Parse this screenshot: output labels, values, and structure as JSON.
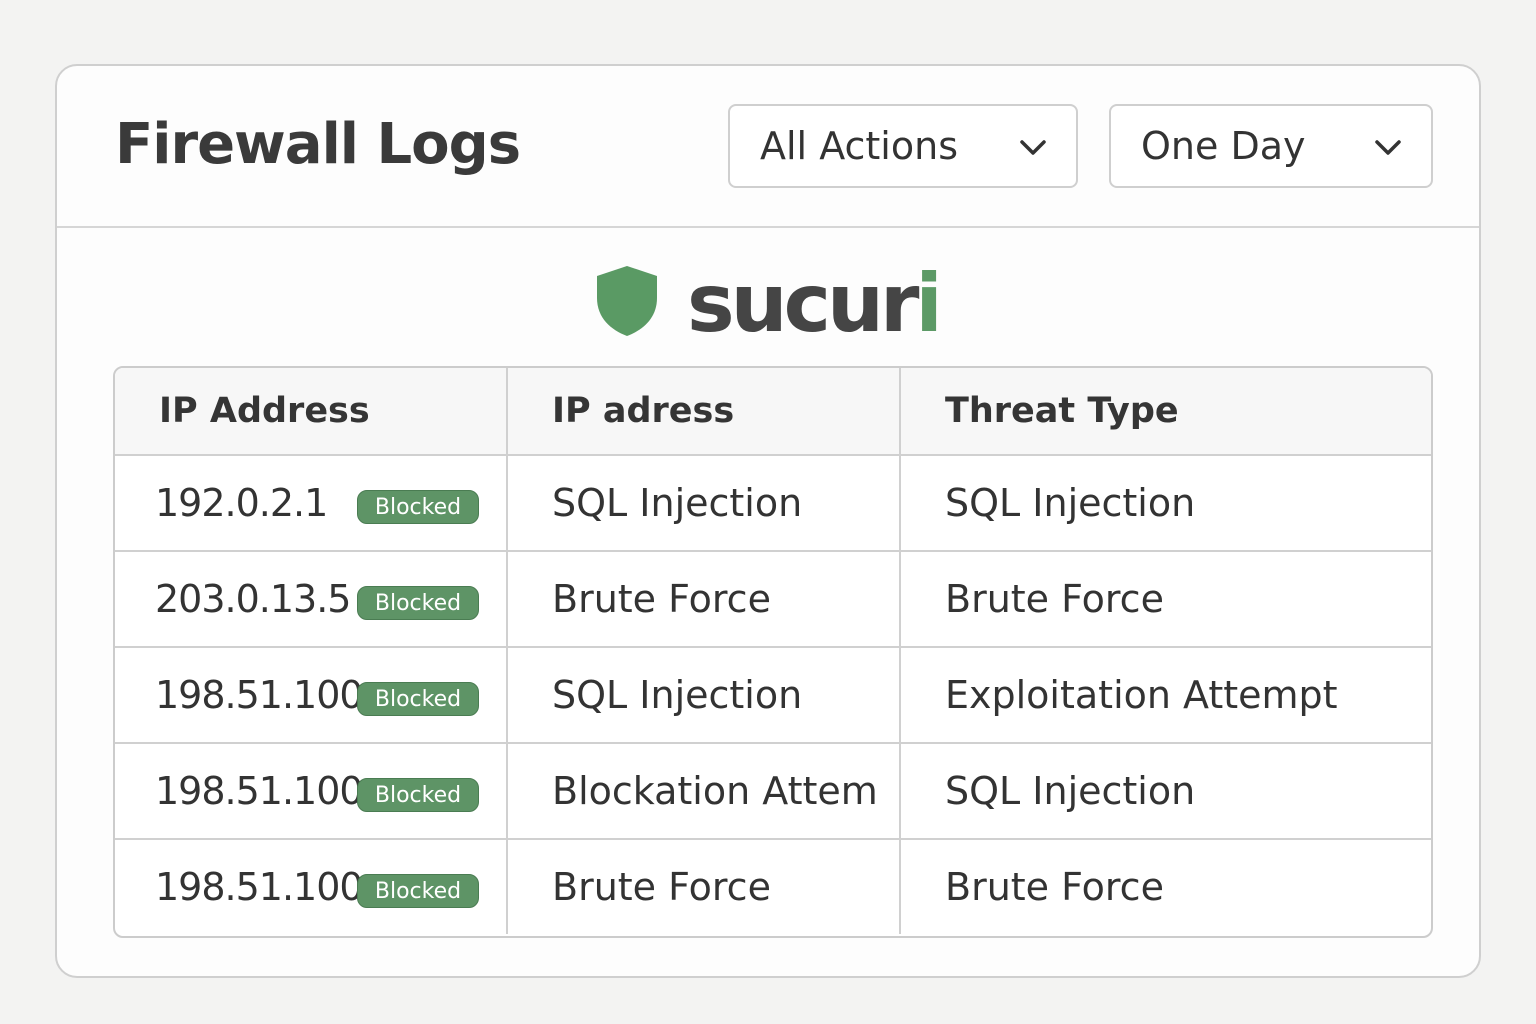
{
  "header": {
    "title": "Firewall Logs",
    "actions_filter": {
      "selected": "All Actions",
      "icon": "chevron-down-icon"
    },
    "range_filter": {
      "selected": "One Day",
      "icon": "chevron-down-icon"
    }
  },
  "logo": {
    "wordmark_main": "sucur",
    "wordmark_accent": "i",
    "icon": "shield-icon",
    "colors": {
      "shield": "#5a9a64",
      "text": "#454545",
      "accent": "#5c9a66"
    }
  },
  "table": {
    "columns": [
      "IP Address",
      "IP adress",
      "Threat Type"
    ],
    "rows": [
      {
        "ip": "192.0.2.1",
        "status": "Blocked",
        "col2": "SQL Injection",
        "threat": "SQL Injection"
      },
      {
        "ip": "203.0.13.5",
        "status": "Blocked",
        "col2": "Brute Force",
        "threat": "Brute Force"
      },
      {
        "ip": "198.51.100",
        "status": "Blocked",
        "col2": "SQL Injection",
        "threat": "Exploitation Attempt"
      },
      {
        "ip": "198.51.100",
        "status": "Blocked",
        "col2": "Blockation Attem",
        "threat": "SQL Injection"
      },
      {
        "ip": "198.51.100",
        "status": "Blocked",
        "col2": "Brute Force",
        "threat": "Brute Force"
      }
    ],
    "badge_color": "#5e9466"
  }
}
